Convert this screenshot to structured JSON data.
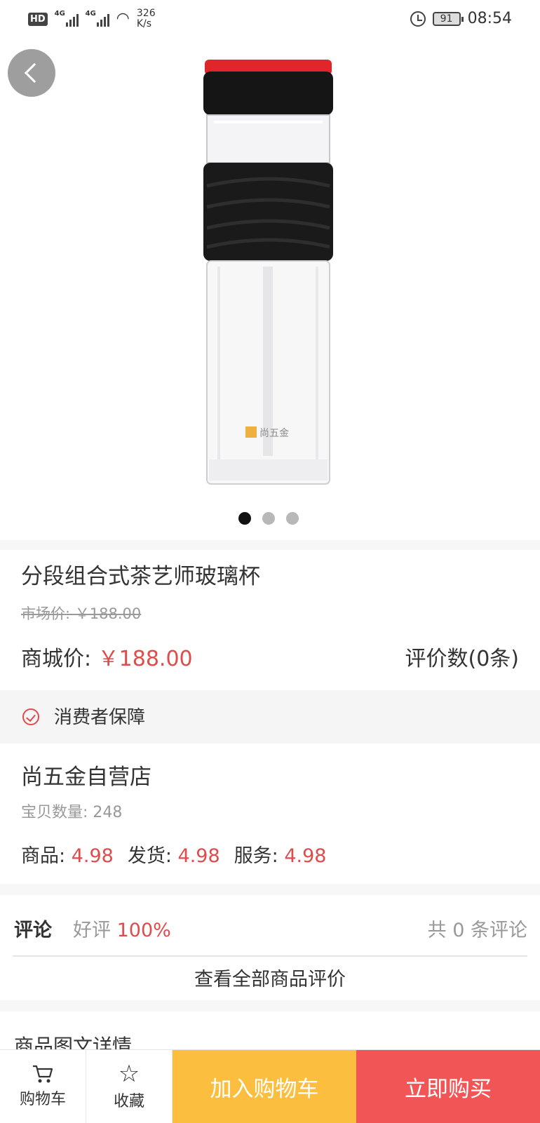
{
  "status_bar": {
    "hd_label": "HD",
    "signal1_label": "4G",
    "signal2_label": "4G",
    "speed_value": "326",
    "speed_unit": "K/s",
    "battery": "91",
    "time": "08:54"
  },
  "product": {
    "image_brand_text": "尚五金",
    "carousel": {
      "count": 3,
      "active_index": 0
    },
    "title": "分段组合式茶艺师玻璃杯",
    "market_price": "市场价: ￥188.00",
    "mall_price_label": "商城价:",
    "mall_price_value": "￥188.00",
    "review_count": "评价数(0条)"
  },
  "guarantee": {
    "label": "消费者保障"
  },
  "store": {
    "name": "尚五金自营店",
    "item_count": "宝贝数量: 248",
    "ratings": [
      {
        "label": "商品:",
        "value": "4.98"
      },
      {
        "label": "发货:",
        "value": "4.98"
      },
      {
        "label": "服务:",
        "value": "4.98"
      }
    ]
  },
  "comments": {
    "title": "评论",
    "good_label": "好评",
    "good_value": "100%",
    "total": "共 0 条评论",
    "view_all": "查看全部商品评价"
  },
  "details": {
    "title": "商品图文详情"
  },
  "bottom_bar": {
    "cart_tab": "购物车",
    "favorite_tab": "收藏",
    "add_to_cart": "加入购物车",
    "buy_now": "立即购买"
  },
  "colors": {
    "price_red": "#e04b4b",
    "add_to_cart_bg": "#fbbe3e",
    "buy_now_bg": "#f25555"
  }
}
